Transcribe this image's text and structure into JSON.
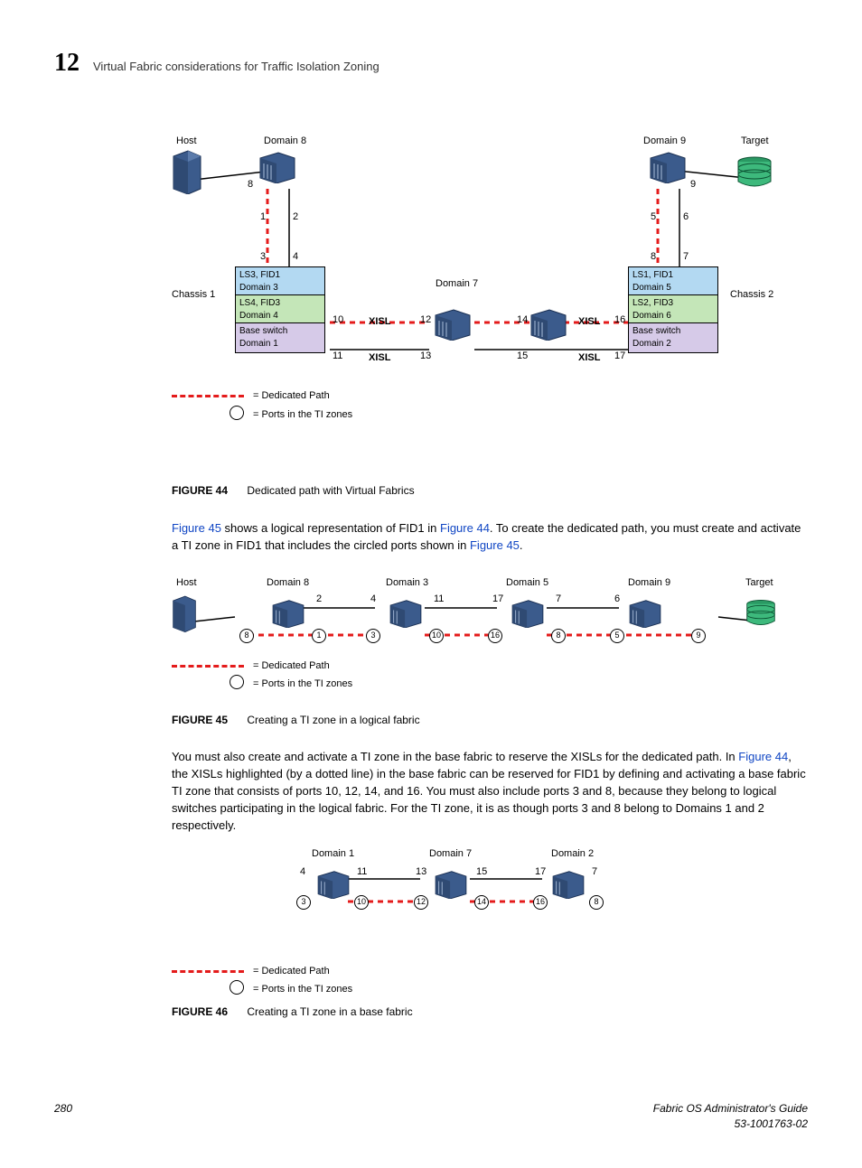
{
  "header": {
    "chapter": "12",
    "title": "Virtual Fabric considerations for Traffic Isolation Zoning"
  },
  "fig44": {
    "host": "Host",
    "target": "Target",
    "domain8": "Domain 8",
    "domain9": "Domain 9",
    "domain7": "Domain 7",
    "chassis1": "Chassis 1",
    "chassis2": "Chassis 2",
    "xisl": "XISL",
    "c1_l1": "LS3, FID1\nDomain 3",
    "c1_l2": "LS4, FID3\nDomain 4",
    "c1_l3": "Base switch\nDomain 1",
    "c2_l1": "LS1, FID1\nDomain 5",
    "c2_l2": "LS2, FID3\nDomain 6",
    "c2_l3": "Base switch\nDomain 2",
    "p8": "8",
    "p1": "1",
    "p2": "2",
    "p3": "3",
    "p4": "4",
    "p5": "5",
    "p6": "6",
    "p7": "7",
    "p8r": "8",
    "p9": "9",
    "p10": "10",
    "p11": "11",
    "p12": "12",
    "p13": "13",
    "p14": "14",
    "p15": "15",
    "p16": "16",
    "p17": "17",
    "legend1": "= Dedicated Path",
    "legend2": "= Ports in the TI zones",
    "caption_label": "FIGURE 44",
    "caption_text": "Dedicated path with Virtual Fabrics"
  },
  "para1": {
    "t1": "Figure 45",
    "t2": " shows a logical representation of FID1 in ",
    "t3": "Figure 44",
    "t4": ". To create the dedicated path, you must create and activate a TI zone in FID1 that includes the circled ports shown in ",
    "t5": "Figure 45",
    "t6": "."
  },
  "fig45": {
    "host": "Host",
    "target": "Target",
    "d8": "Domain 8",
    "d3": "Domain 3",
    "d5": "Domain 5",
    "d9": "Domain 9",
    "top": {
      "a": "2",
      "b": "4",
      "c": "11",
      "d": "17",
      "e": "7",
      "f": "6"
    },
    "circ": {
      "a": "8",
      "b": "1",
      "c": "3",
      "d": "10",
      "e": "16",
      "f": "8",
      "g": "5",
      "h": "9"
    },
    "legend1": "= Dedicated Path",
    "legend2": "= Ports in the TI zones",
    "caption_label": "FIGURE 45",
    "caption_text": "Creating a TI zone in a logical fabric"
  },
  "para2": {
    "t1": "You must also create and activate a TI zone in the base fabric to reserve the XISLs for the dedicated path. In ",
    "t2": "Figure 44",
    "t3": ", the XISLs highlighted (by a dotted line) in the base fabric can be reserved for FID1 by defining and activating a base fabric TI zone that consists of ports 10, 12, 14, and 16. You must also include ports 3 and 8, because they belong to logical switches participating in the logical fabric. For the TI zone, it is as though ports 3 and 8 belong to Domains 1 and 2 respectively."
  },
  "fig46": {
    "d1": "Domain 1",
    "d7": "Domain 7",
    "d2": "Domain 2",
    "top": {
      "a": "4",
      "b": "11",
      "c": "13",
      "d": "15",
      "e": "17",
      "f": "7"
    },
    "circ": {
      "a": "3",
      "b": "10",
      "c": "12",
      "d": "14",
      "e": "16",
      "f": "8"
    },
    "legend1": "= Dedicated Path",
    "legend2": "= Ports in the TI zones",
    "caption_label": "FIGURE 46",
    "caption_text": "Creating a TI zone in a base fabric"
  },
  "footer": {
    "page": "280",
    "title": "Fabric OS Administrator's Guide",
    "docid": "53-1001763-02"
  }
}
